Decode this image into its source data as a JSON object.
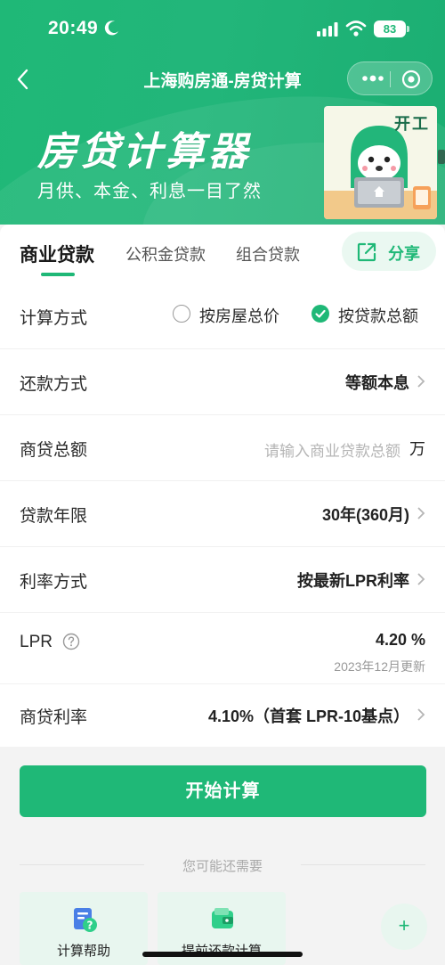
{
  "status": {
    "time": "20:49",
    "battery": "83"
  },
  "nav": {
    "title": "上海购房通-房贷计算"
  },
  "banner": {
    "title": "房贷计算器",
    "subtitle": "月供、本金、利息一目了然",
    "mascot_label": "开工"
  },
  "tabs": [
    {
      "label": "商业贷款",
      "active": true
    },
    {
      "label": "公积金贷款",
      "active": false
    },
    {
      "label": "组合贷款",
      "active": false
    }
  ],
  "share_label": "分享",
  "form": {
    "calc_method": {
      "label": "计算方式",
      "option1": "按房屋总价",
      "option2": "按贷款总额",
      "selected": "按贷款总额"
    },
    "repay_method": {
      "label": "还款方式",
      "value": "等额本息"
    },
    "loan_amount": {
      "label": "商贷总额",
      "placeholder": "请输入商业贷款总额",
      "unit": "万"
    },
    "loan_term": {
      "label": "贷款年限",
      "value": "30年(360月)"
    },
    "rate_method": {
      "label": "利率方式",
      "value": "按最新LPR利率"
    },
    "lpr": {
      "label": "LPR",
      "value": "4.20 %",
      "note": "2023年12月更新"
    },
    "commercial_rate": {
      "label": "商贷利率",
      "value": "4.10%（首套 LPR-10基点）"
    }
  },
  "calc_button": "开始计算",
  "more_section": "您可能还需要",
  "tools": [
    {
      "label": "计算帮助",
      "icon": "help-document-icon"
    },
    {
      "label": "提前还款计算",
      "icon": "wallet-icon"
    }
  ],
  "colors": {
    "brand": "#1fb877",
    "brand_light": "#e8f6ef"
  }
}
